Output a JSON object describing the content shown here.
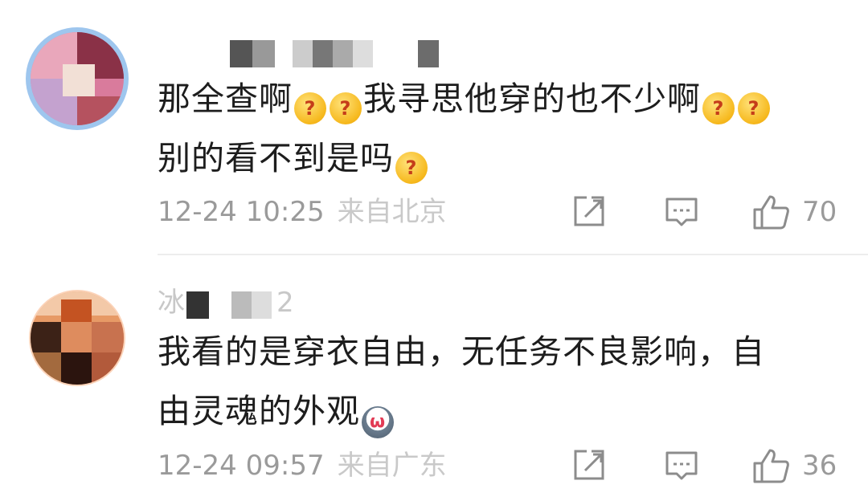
{
  "comments": [
    {
      "username": " ",
      "lines": [
        "那全查啊",
        "我寻思他穿的也不少啊",
        "别的看不到是吗"
      ],
      "time": "12-24 10:25",
      "location": "来自北京",
      "likes": "70"
    },
    {
      "username": "冰",
      "username_tail": "2",
      "lines": [
        "我看的是穿衣自由，无任务不良影响，自",
        "由灵魂的外观"
      ],
      "time": "12-24 09:57",
      "location": "来自广东",
      "likes": "36"
    }
  ],
  "icons": {
    "share": "share-icon",
    "reply": "comment-icon",
    "like": "thumbs-up-icon",
    "emoji_think": "thinking-emoji-icon",
    "emoji_dog": "husky-emoji-icon"
  },
  "colors": {
    "text": "#1d1d1d",
    "meta": "#9a9a9a",
    "divider": "#ededed"
  }
}
